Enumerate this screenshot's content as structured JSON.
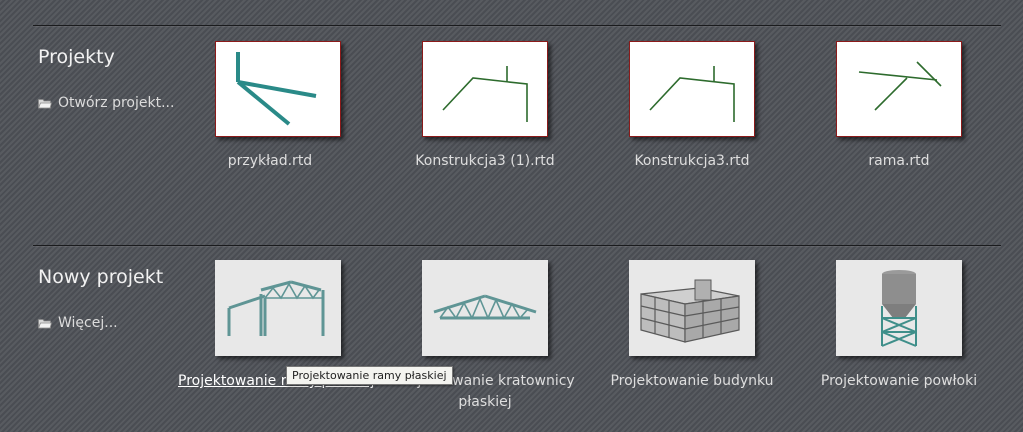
{
  "projects": {
    "title": "Projekty",
    "open_label": "Otwórz projekt...",
    "items": [
      {
        "name": "przykład.rtd"
      },
      {
        "name": "Konstrukcja3 (1).rtd"
      },
      {
        "name": "Konstrukcja3.rtd"
      },
      {
        "name": "rama.rtd"
      }
    ]
  },
  "new_project": {
    "title": "Nowy projekt",
    "more_label": "Więcej...",
    "items": [
      {
        "label": "Projektowanie ramy płaskiej"
      },
      {
        "label": "Projektowanie kratownicy płaskiej"
      },
      {
        "label": "Projektowanie budynku"
      },
      {
        "label": "Projektowanie powłoki"
      }
    ]
  },
  "tooltip": "Projektowanie ramy płaskiej",
  "colors": {
    "thumb_border": "#8b1a1a",
    "structure_green": "#2d6b2d",
    "structure_teal": "#2a8a88"
  },
  "icons": {
    "open": "folder-open-icon"
  }
}
